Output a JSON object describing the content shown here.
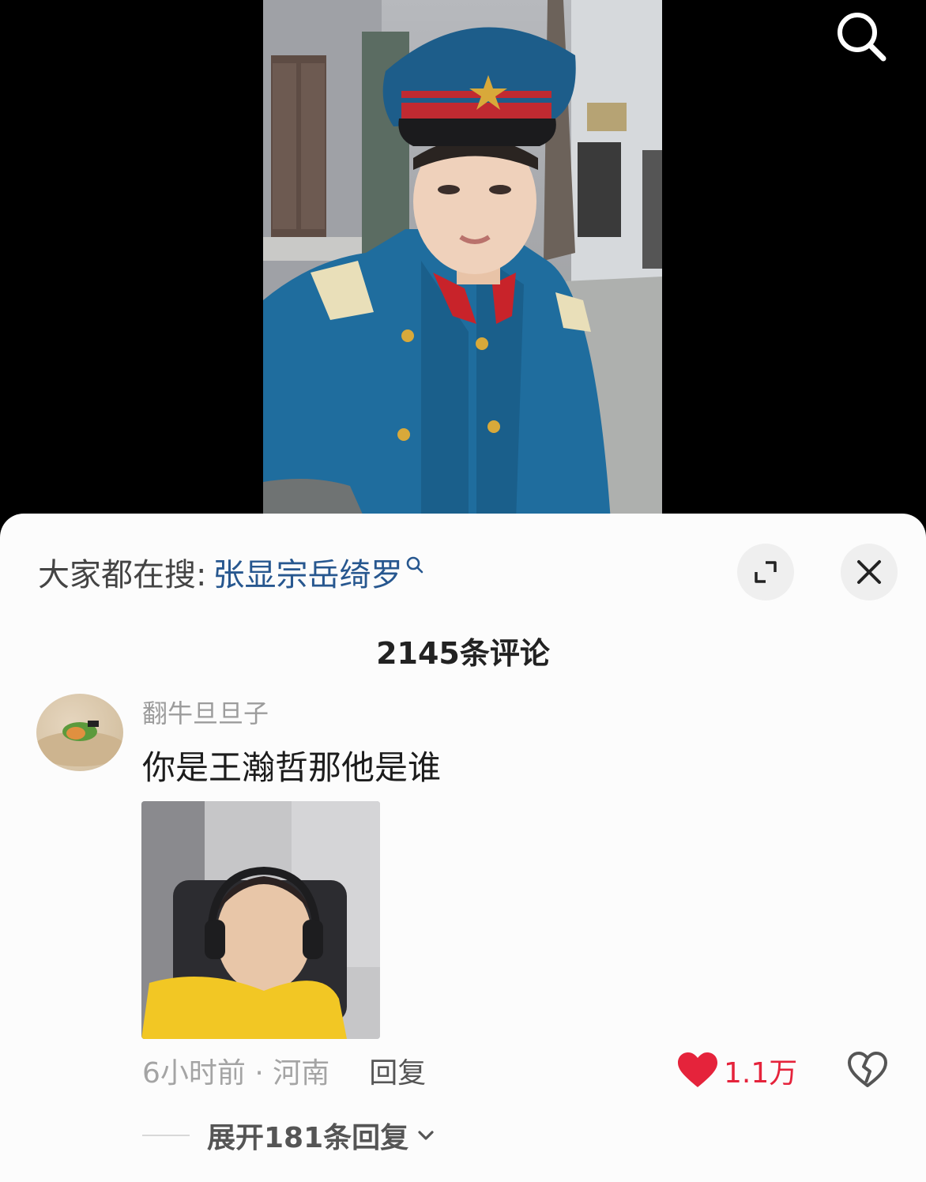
{
  "video": {
    "description_icon": "search-icon"
  },
  "comments_panel": {
    "suggest_prefix": "大家都在搜:",
    "suggest_term": "张显宗岳绮罗",
    "comment_count_label": "2145条评论",
    "comment": {
      "username": "翻牛旦旦子",
      "text": "你是王瀚哲那他是谁",
      "time_location": "6小时前 · 河南",
      "reply_label": "回复",
      "like_count": "1.1万",
      "expand_replies_label": "展开181条回复"
    }
  },
  "colors": {
    "accent_link": "#27578f",
    "like_red": "#e5233b",
    "uniform_blue": "#1f6d9e"
  }
}
